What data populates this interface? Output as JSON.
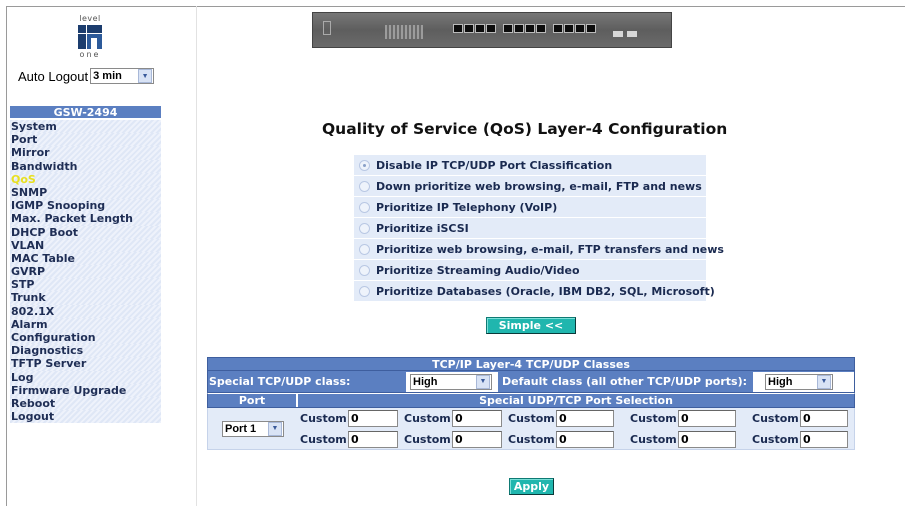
{
  "logo": {
    "top_text": "level",
    "bottom_text": "one"
  },
  "autologout": {
    "label": "Auto Logout",
    "value": "3 min"
  },
  "menu": {
    "header": "GSW-2494",
    "items": [
      "System",
      "Port",
      "Mirror",
      "Bandwidth",
      "QoS",
      "SNMP",
      "IGMP Snooping",
      "Max. Packet Length",
      "DHCP Boot",
      "VLAN",
      "MAC Table",
      "GVRP",
      "STP",
      "Trunk",
      "802.1X",
      "Alarm",
      "Configuration",
      "Diagnostics",
      "TFTP Server",
      "Log",
      "Firmware Upgrade",
      "Reboot",
      "Logout"
    ],
    "active": "QoS"
  },
  "page": {
    "title": "Quality of Service (QoS) Layer-4 Configuration"
  },
  "options": [
    {
      "label": "Disable IP TCP/UDP Port Classification",
      "checked": true
    },
    {
      "label": "Down prioritize web browsing, e-mail, FTP and news",
      "checked": false
    },
    {
      "label": "Prioritize IP Telephony (VoIP)",
      "checked": false
    },
    {
      "label": "Prioritize iSCSI",
      "checked": false
    },
    {
      "label": "Prioritize web browsing, e-mail, FTP transfers and news",
      "checked": false
    },
    {
      "label": "Prioritize Streaming Audio/Video",
      "checked": false
    },
    {
      "label": "Prioritize Databases (Oracle, IBM DB2, SQL, Microsoft)",
      "checked": false
    }
  ],
  "simple_button": "Simple <<",
  "classes": {
    "header": "TCP/IP Layer-4 TCP/UDP Classes",
    "special_label": "Special TCP/UDP class:",
    "special_value": "High",
    "default_label": "Default class (all other TCP/UDP ports):",
    "default_value": "High",
    "port_header": "Port",
    "selection_header": "Special UDP/TCP Port Selection",
    "port_value": "Port 1",
    "custom_label": "Custom:",
    "custom_values": [
      "0",
      "0",
      "0",
      "0",
      "0",
      "0",
      "0",
      "0",
      "0",
      "0"
    ]
  },
  "apply_button": "Apply"
}
